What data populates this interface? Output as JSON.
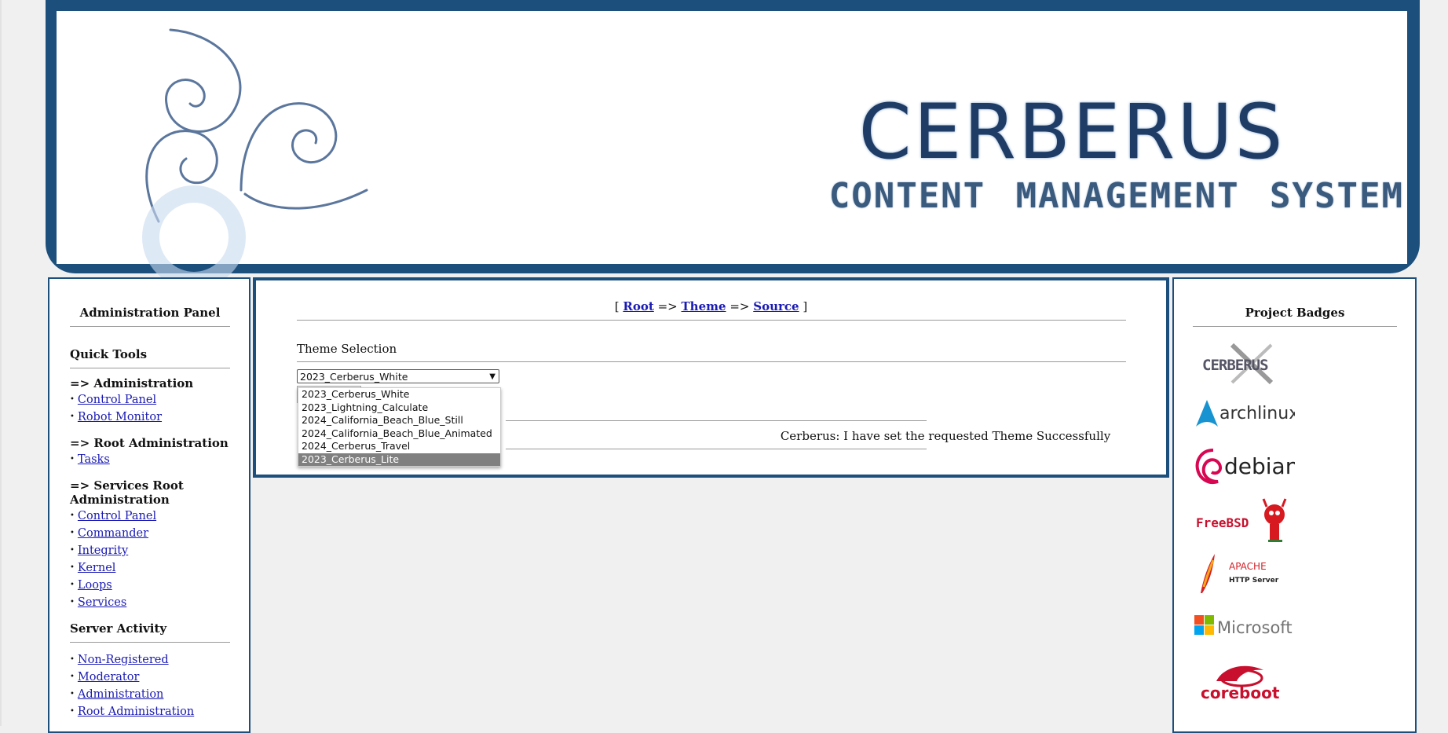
{
  "banner": {
    "title": "CERBERUS",
    "subtitle": "CONTENT MANAGEMENT SYSTEM"
  },
  "left_panel": {
    "heading": "Administration Panel",
    "quick_tools_title": "Quick Tools",
    "groups": [
      {
        "label": "=> Administration",
        "items": [
          "Control Panel",
          "Robot Monitor"
        ]
      },
      {
        "label": "=> Root Administration",
        "items": [
          "Tasks"
        ]
      },
      {
        "label": "=> Services Root Administration",
        "items": [
          "Control Panel",
          "Commander",
          "Integrity",
          "Kernel",
          "Loops",
          "Services"
        ]
      }
    ],
    "server_activity_title": "Server Activity",
    "server_activity_items": [
      "Non-Registered",
      "Moderator",
      "Administration",
      "Root Administration"
    ]
  },
  "center": {
    "breadcrumb": {
      "open": "[",
      "arrow": "=>",
      "close": "]",
      "items": [
        "Root",
        "Theme",
        "Source"
      ]
    },
    "theme_label": "Theme Selection",
    "select_value": "2023_Cerberus_White",
    "options": [
      "2023_Cerberus_White",
      "2023_Lightning_Calculate",
      "2024_California_Beach_Blue_Still",
      "2024_California_Beach_Blue_Animated",
      "2024_Cerberus_Travel",
      "2023_Cerberus_Lite"
    ],
    "highlighted_option": "2023_Cerberus_Lite",
    "message": "Cerberus: I have set the requested Theme Successfully"
  },
  "right_panel": {
    "heading": "Project Badges",
    "badges": [
      {
        "icon": "cerberus-badge-icon"
      },
      {
        "icon": "archlinux-badge-icon",
        "text": "archlinux"
      },
      {
        "icon": "debian-badge-icon",
        "text": "debian"
      },
      {
        "icon": "freebsd-badge-icon",
        "text": "FreeBSD"
      },
      {
        "icon": "apache-badge-icon",
        "text": "APACHE",
        "subtext": "HTTP Server"
      },
      {
        "icon": "microsoft-badge-icon",
        "text": "Microsoft"
      },
      {
        "icon": "coreboot-badge-icon",
        "text": "coreboot"
      }
    ]
  },
  "colors": {
    "frame_blue": "#1d4f7c",
    "link_blue": "#1a1ab4",
    "page_background": "#f0f0f0"
  }
}
